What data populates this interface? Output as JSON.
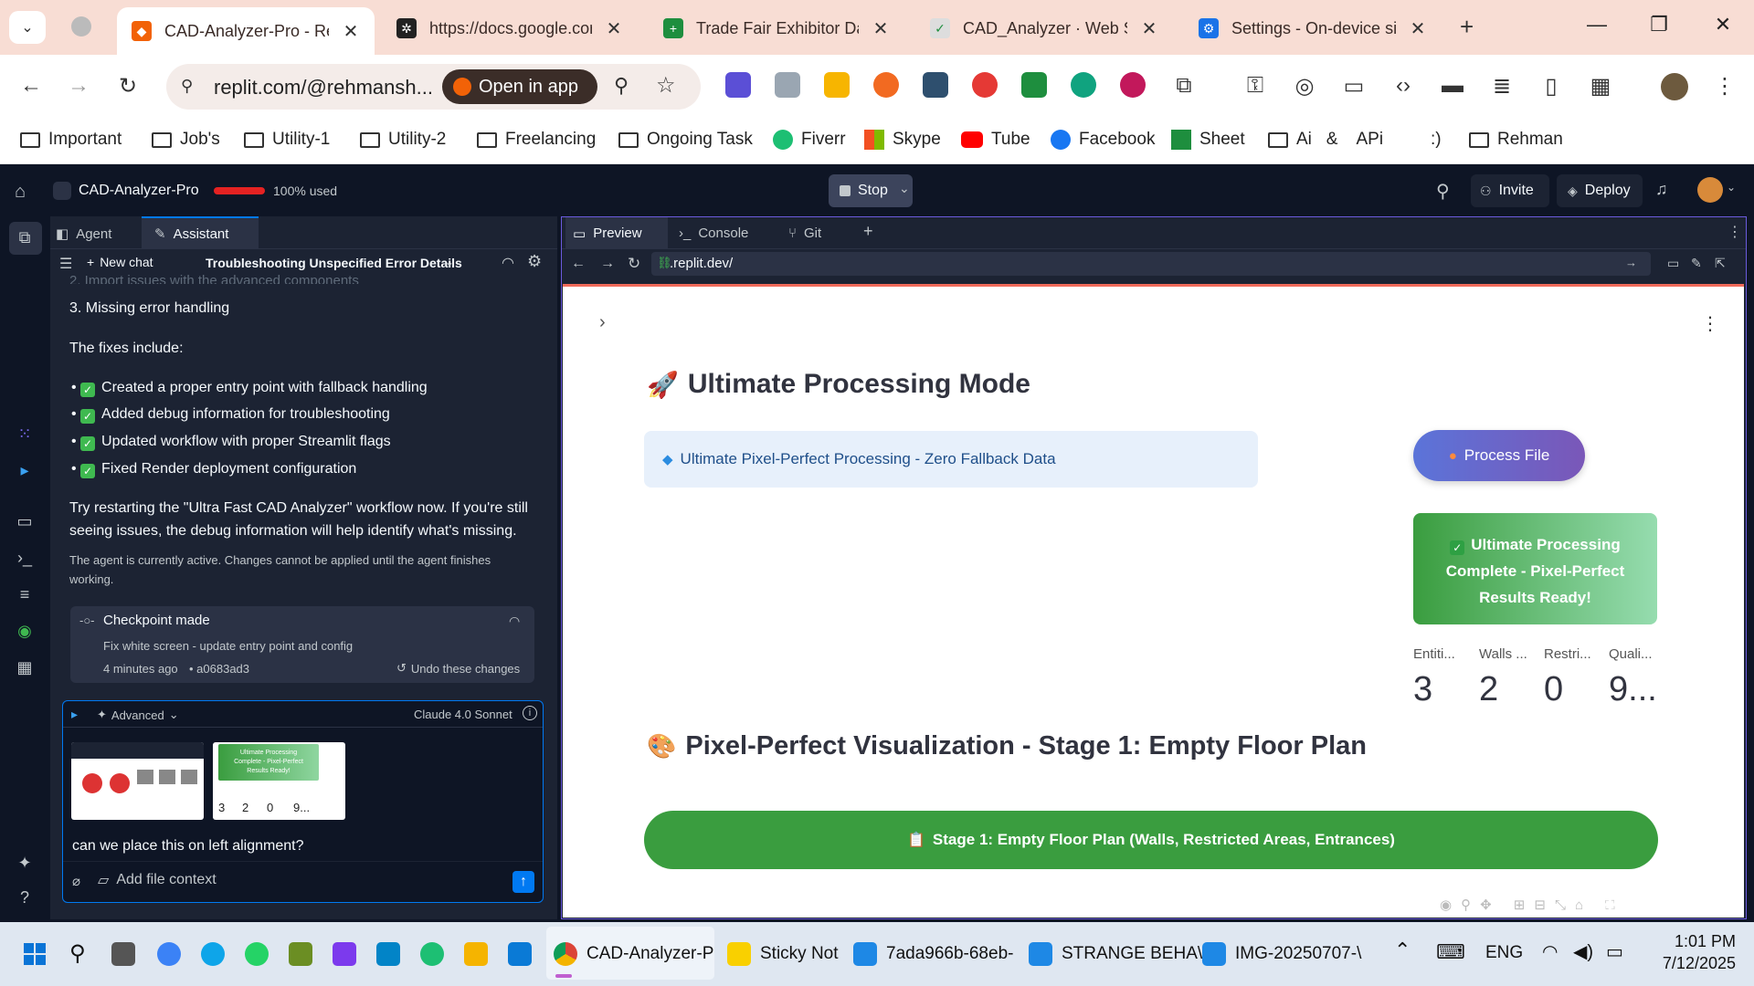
{
  "browser": {
    "tabs": [
      {
        "title": "CAD-Analyzer-Pro - Re",
        "active": true
      },
      {
        "title": "https://docs.google.con"
      },
      {
        "title": "Trade Fair Exhibitor Dat"
      },
      {
        "title": "CAD_Analyzer · Web Se"
      },
      {
        "title": "Settings - On-device sit"
      }
    ],
    "url": "replit.com/@rehmansh...",
    "open_in_app": "Open in app",
    "bookmarks": [
      "Important",
      "Job's",
      "Utility-1",
      "Utility-2",
      "Freelancing",
      "Ongoing Task",
      "Fiverr",
      "Skype",
      "Tube",
      "Facebook",
      "Sheet",
      "Ai   &    APi",
      ":)",
      "Rehman"
    ]
  },
  "replit": {
    "project": "CAD-Analyzer-Pro",
    "usage": "100% used",
    "stop": "Stop",
    "invite": "Invite",
    "deploy": "Deploy"
  },
  "assistant": {
    "tab_agent": "Agent",
    "tab_assistant": "Assistant",
    "new_chat": "New chat",
    "thread_title": "Troubleshooting Unspecified Error Details",
    "faded_line": "2. Import issues with the advanced components",
    "line3": "3. Missing error handling",
    "fixes_intro": "The fixes include:",
    "fixes": [
      "Created a proper entry point with fallback handling",
      "Added debug information for troubleshooting",
      "Updated workflow with proper Streamlit flags",
      "Fixed Render deployment configuration"
    ],
    "advice_1": "Try restarting the \"Ultra Fast CAD Analyzer\" workflow now. If you're still",
    "advice_2": "seeing issues, the debug information will help identify what's missing.",
    "note_1": "The agent is currently active. Changes cannot be applied until the agent finishes",
    "note_2": "working.",
    "checkpoint_title": "Checkpoint made",
    "checkpoint_desc": "Fix white screen - update entry point and config",
    "checkpoint_time": "4 minutes ago",
    "checkpoint_hash": "• a0683ad3",
    "undo": "Undo these changes",
    "mode": "Advanced",
    "model": "Claude 4.0 Sonnet",
    "input_value": "can we place this on left alignment?",
    "add_context": "Add file context"
  },
  "preview": {
    "tab_preview": "Preview",
    "tab_console": "Console",
    "tab_git": "Git",
    "address": ".replit.dev/",
    "heading1": "Ultimate Processing Mode",
    "info": "Ultimate Pixel-Perfect Processing - Zero Fallback Data",
    "process_btn": "Process File",
    "success_1": "Ultimate Processing",
    "success_2": "Complete - Pixel-Perfect",
    "success_3": "Results Ready!",
    "metrics": [
      {
        "label": "Entiti...",
        "value": "3"
      },
      {
        "label": "Walls ...",
        "value": "2"
      },
      {
        "label": "Restri...",
        "value": "0"
      },
      {
        "label": "Quali...",
        "value": "9..."
      }
    ],
    "heading2": "Pixel-Perfect Visualization - Stage 1: Empty Floor Plan",
    "stage_bar": "Stage 1: Empty Floor Plan (Walls, Restricted Areas, Entrances)",
    "thumb2_text_1": "Ultimate Processing",
    "thumb2_text_2": "Complete - Pixel-Perfect",
    "thumb2_text_3": "Results Ready!"
  },
  "taskbar": {
    "items": [
      "CAD-Analyzer-P",
      "Sticky Not",
      "7ada966b-68eb-",
      "STRANGE BEHA\\",
      "IMG-20250707-\\"
    ],
    "lang": "ENG",
    "time": "1:01 PM",
    "date": "7/12/2025"
  },
  "colors": {
    "accent_purple": "#6b5bde",
    "success_green": "#3fb950",
    "stage_green": "#3a9d3f",
    "replit_bg": "#0e1525",
    "panel_bg": "#1c2333"
  }
}
